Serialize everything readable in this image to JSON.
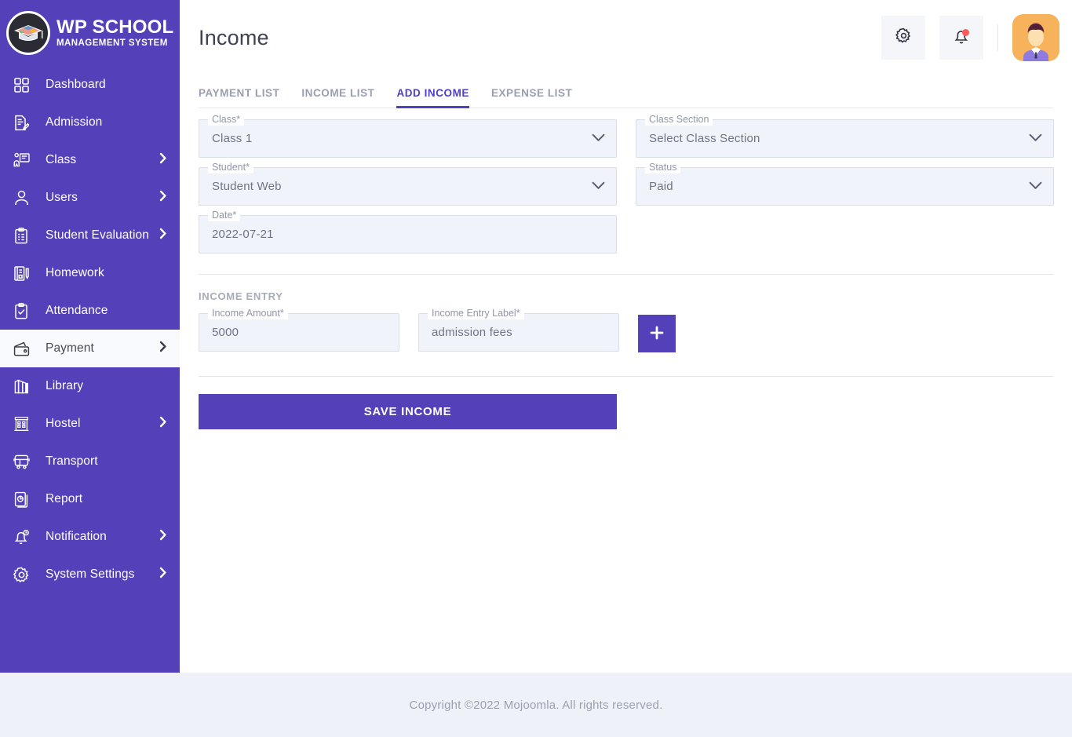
{
  "brand": {
    "title": "WP SCHOOL",
    "subtitle": "MANAGEMENT SYSTEM"
  },
  "colors": {
    "sidebar": "#5440b8",
    "accent": "#4f3fc4",
    "button": "#5440b8",
    "field_bg": "#f0f3f9",
    "footer_bg": "#eef2f8",
    "notification_dot": "#ff5a5a",
    "avatar_bg": "#f7b35c"
  },
  "sidebar": {
    "items": [
      {
        "label": "Dashboard",
        "icon": "grid-icon",
        "expandable": false,
        "active": false
      },
      {
        "label": "Admission",
        "icon": "document-edit-icon",
        "expandable": false,
        "active": false
      },
      {
        "label": "Class",
        "icon": "teacher-board-icon",
        "expandable": true,
        "active": false
      },
      {
        "label": "Users",
        "icon": "user-icon",
        "expandable": true,
        "active": false
      },
      {
        "label": "Student Evaluation",
        "icon": "clipboard-check-icon",
        "expandable": true,
        "active": false
      },
      {
        "label": "Homework",
        "icon": "notebook-pen-icon",
        "expandable": false,
        "active": false
      },
      {
        "label": "Attendance",
        "icon": "clipboard-tick-icon",
        "expandable": false,
        "active": false
      },
      {
        "label": "Payment",
        "icon": "wallet-icon",
        "expandable": true,
        "active": true
      },
      {
        "label": "Library",
        "icon": "books-icon",
        "expandable": false,
        "active": false
      },
      {
        "label": "Hostel",
        "icon": "building-icon",
        "expandable": true,
        "active": false
      },
      {
        "label": "Transport",
        "icon": "bus-icon",
        "expandable": false,
        "active": false
      },
      {
        "label": "Report",
        "icon": "report-chart-icon",
        "expandable": false,
        "active": false
      },
      {
        "label": "Notification",
        "icon": "bell-icon",
        "expandable": true,
        "active": false
      },
      {
        "label": "System Settings",
        "icon": "gear-icon",
        "expandable": true,
        "active": false
      }
    ]
  },
  "header": {
    "title": "Income",
    "settings_icon": "gear-icon",
    "notifications_icon": "bell-icon",
    "has_notification": true,
    "avatar_icon": "user-avatar"
  },
  "tabs": [
    {
      "label": "PAYMENT LIST",
      "active": false
    },
    {
      "label": "INCOME LIST",
      "active": false
    },
    {
      "label": "ADD INCOME",
      "active": true
    },
    {
      "label": "EXPENSE LIST",
      "active": false
    }
  ],
  "form": {
    "class": {
      "label": "Class*",
      "value": "Class 1"
    },
    "class_section": {
      "label": "Class Section",
      "value": "Select Class Section"
    },
    "student": {
      "label": "Student*",
      "value": "Student Web"
    },
    "status": {
      "label": "Status",
      "value": "Paid"
    },
    "date": {
      "label": "Date*",
      "value": "2022-07-21"
    }
  },
  "income_entry": {
    "section_label": "INCOME ENTRY",
    "amount": {
      "label": "Income Amount*",
      "value": "5000"
    },
    "entry_label": {
      "label": "Income Entry Label*",
      "value": "admission fees"
    },
    "add_button": "+"
  },
  "actions": {
    "save_label": "SAVE INCOME"
  },
  "footer": {
    "text": "Copyright ©2022 Mojoomla. All rights reserved."
  }
}
